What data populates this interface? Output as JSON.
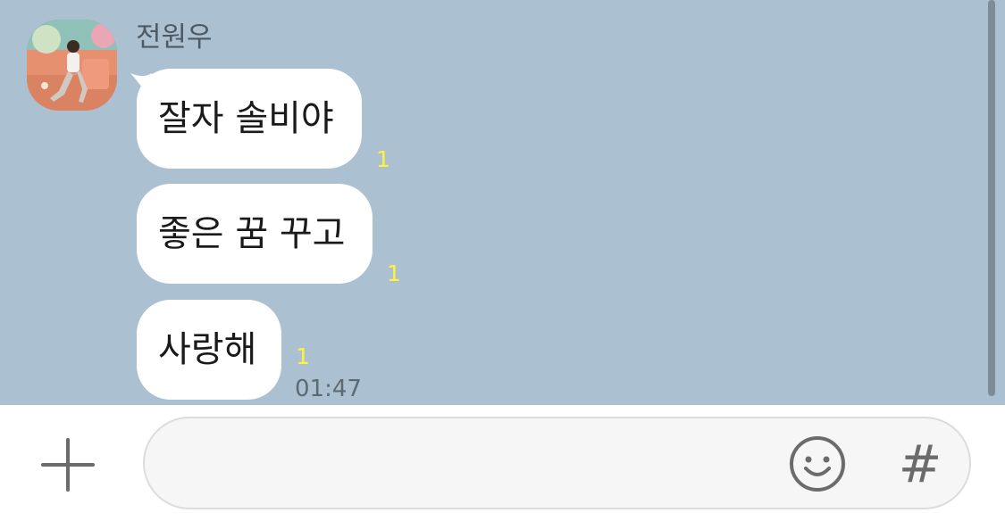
{
  "chat": {
    "sender_name": "전원우",
    "timestamp": "01:47",
    "messages": [
      {
        "text": "잘자 솔비야",
        "unread": "1"
      },
      {
        "text": "좋은 꿈 꾸고",
        "unread": "1"
      },
      {
        "text": "사랑해",
        "unread": "1"
      }
    ]
  },
  "input_bar": {
    "placeholder": "",
    "value": "",
    "hash_label": "#",
    "icons": [
      "plus-icon",
      "emoji-icon",
      "hash-icon"
    ]
  },
  "colors": {
    "chat_background": "#abc1d1",
    "bubble": "#ffffff",
    "unread_count": "#fff23a",
    "input_bar": "#ffffff"
  }
}
